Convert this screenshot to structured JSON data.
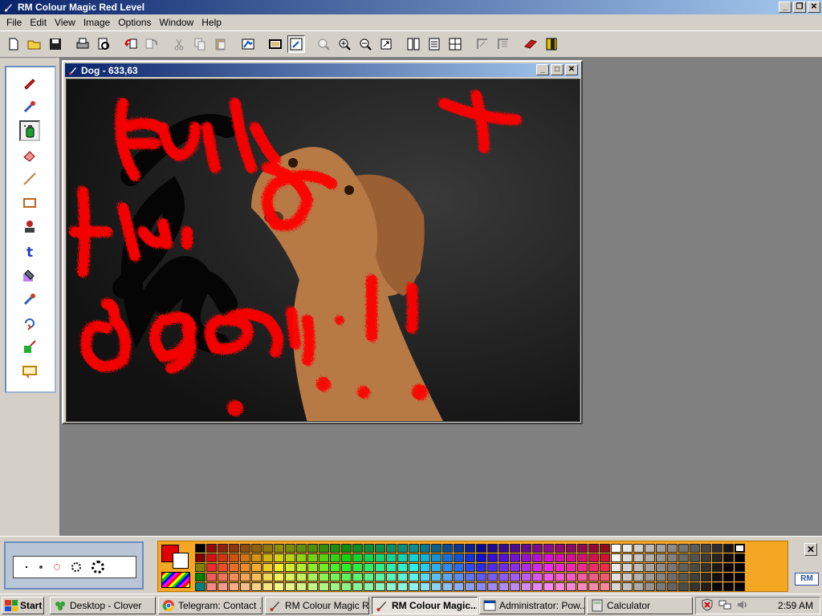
{
  "window": {
    "title": "RM Colour Magic Red Level"
  },
  "menu": [
    "File",
    "Edit",
    "View",
    "Image",
    "Options",
    "Window",
    "Help"
  ],
  "toolbar": {
    "icons": [
      "new-icon",
      "open-icon",
      "save-icon",
      "print-icon",
      "print-preview-icon",
      "undo-icon",
      "redo-icon",
      "cut-icon",
      "copy-icon",
      "paste-icon",
      "edit-picture-icon",
      "frame-icon",
      "frame-select-icon",
      "zoom-fit-icon",
      "zoom-in-icon",
      "zoom-out-icon",
      "zoom-icon",
      "layers-icon",
      "align-icon",
      "grid-icon",
      "flip-icon",
      "mirror-icon",
      "book-icon",
      "exit-icon"
    ]
  },
  "tools": [
    "pencil-icon",
    "brush-icon",
    "spray-can-icon",
    "eraser-icon",
    "line-icon",
    "rectangle-icon",
    "stamp-icon",
    "text-icon",
    "fill-icon",
    "eyedropper-icon",
    "rotate-icon",
    "shape-tool-icon",
    "frame-tool-icon"
  ],
  "document": {
    "title": "Dog - 633,63"
  },
  "palette": {
    "foreground": "#e00000",
    "background": "#ffffff"
  },
  "taskbar": {
    "start_label": "Start",
    "tasks": [
      "Desktop - Clover",
      "Telegram: Contact ...",
      "RM Colour Magic R...",
      "RM Colour Magic...",
      "Administrator: Pow...",
      "Calculator"
    ],
    "clock": "2:59 AM"
  }
}
